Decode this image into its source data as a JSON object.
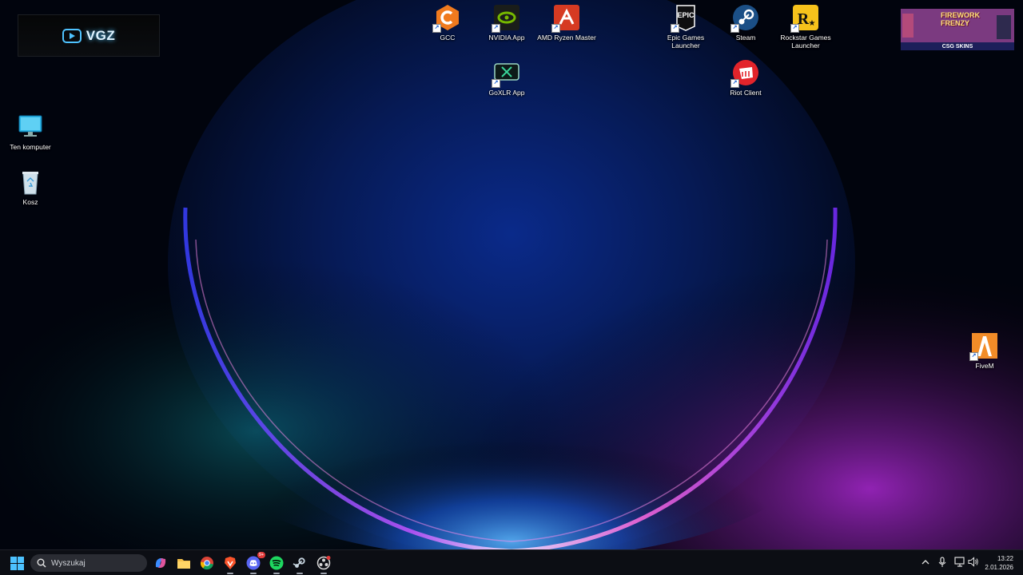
{
  "desktop": {
    "icons": [
      {
        "label": "GCC"
      },
      {
        "label": "NVIDIA App"
      },
      {
        "label": "AMD Ryzen Master"
      },
      {
        "label": "Epic Games Launcher"
      },
      {
        "label": "Steam"
      },
      {
        "label": "Rockstar Games Launcher"
      },
      {
        "label": "GoXLR App"
      },
      {
        "label": "Riot Client"
      },
      {
        "label": "Ten komputer"
      },
      {
        "label": "Kosz"
      },
      {
        "label": "FiveM"
      }
    ]
  },
  "widgets": {
    "vgz_text": "VGZ",
    "csg_title": "FIREWORK FRENZY",
    "csg_brand": "CSG SKINS"
  },
  "taskbar": {
    "search_placeholder": "Wyszukaj",
    "discord_badge": "9+",
    "time": "13:22",
    "date": "2.01.2026"
  },
  "colors": {
    "taskbar_bg": "#0c0e14",
    "search_bg": "#2a2c33",
    "accent_blue": "#1f6fe8"
  }
}
